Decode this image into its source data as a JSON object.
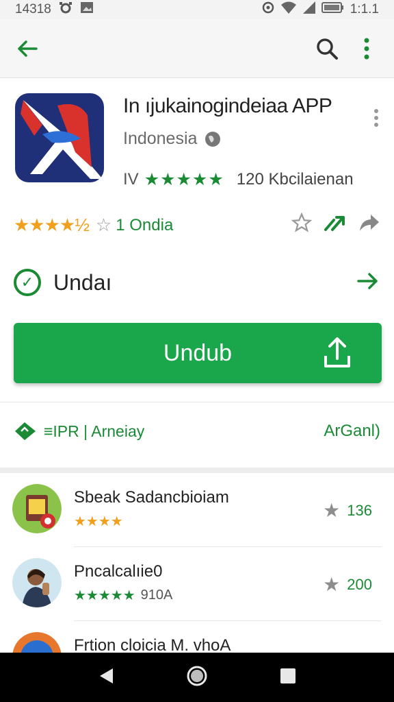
{
  "status_bar": {
    "time": "14318",
    "clock_right": "1:1.1"
  },
  "app": {
    "title": "In ıjukainogindeiaa APP",
    "developer": "Indonesia",
    "rating_prefix": "IV",
    "rating_stars": "★★★★★",
    "downloads": "120 Kbcilaienan",
    "user_stars": "★★★★½",
    "user_rating_text": "1 Ondia",
    "accent_color": "#1aa64a"
  },
  "install": {
    "label": "Undaı",
    "button_label": "Undub"
  },
  "info": {
    "left_text": "≡IPR | Arneiay",
    "right_text": "ArGanl)"
  },
  "related": [
    {
      "name": "Sbeak Sadancbioiam",
      "stars": "★★★★",
      "meta": "",
      "score": "136"
    },
    {
      "name": "Pncalcalıie0",
      "stars": "★★★★★",
      "meta": "910A",
      "score": "200"
    },
    {
      "name": "Frtion cloicia M. vhoA",
      "stars": "",
      "meta": "",
      "score": ""
    }
  ]
}
